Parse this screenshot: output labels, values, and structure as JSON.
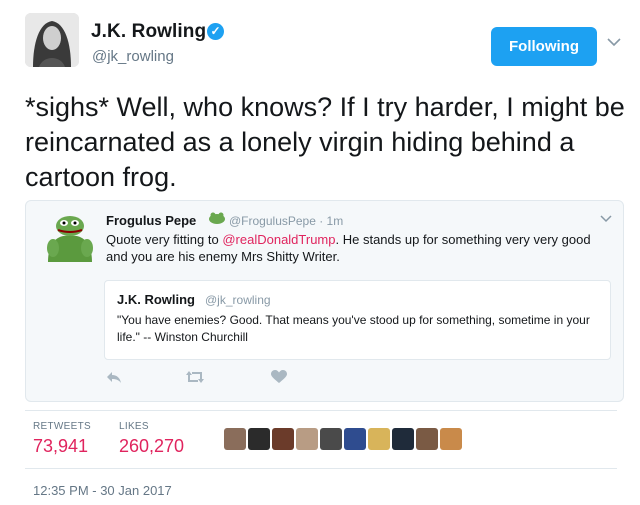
{
  "author": {
    "name": "J.K. Rowling",
    "handle": "@jk_rowling",
    "verified_icon": "verified-badge-icon"
  },
  "follow_button": {
    "label": "Following"
  },
  "tweet": {
    "text": "*sighs* Well, who knows? If I try harder, I might be reincarnated as a lonely virgin hiding behind a cartoon frog."
  },
  "quoted": {
    "name": "Frogulus Pepe",
    "handle": "@FrogulusPepe · 1m",
    "text_before": "Quote very fitting to ",
    "mention": "@realDonaldTrump",
    "text_after": ". He stands up for something very very good and you are his enemy Mrs Shitty Writer.",
    "inner": {
      "name": "J.K. Rowling",
      "handle": "@jk_rowling",
      "text": "\"You have enemies? Good. That means you've stood up for something, sometime in your life.\" -- Winston Churchill"
    }
  },
  "stats": {
    "retweets_label": "RETWEETS",
    "retweets_value": "73,941",
    "likes_label": "LIKES",
    "likes_value": "260,270",
    "accent_color": "#e0245e"
  },
  "timestamp": "12:35 PM - 30 Jan 2017",
  "colors": {
    "brand": "#1da1f2",
    "muted": "#657786"
  }
}
